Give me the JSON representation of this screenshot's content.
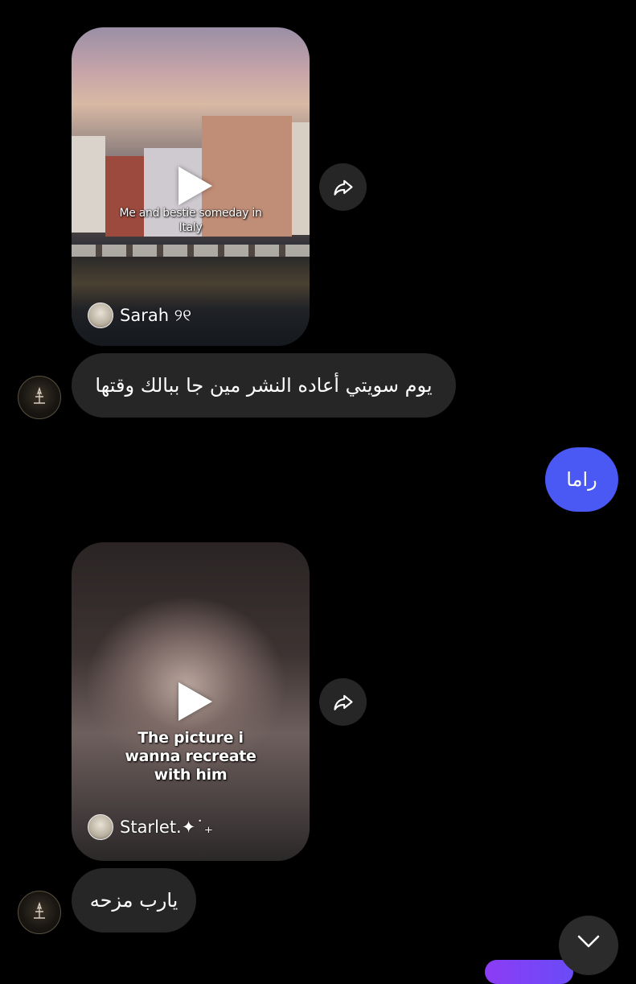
{
  "messages": [
    {
      "type": "reel",
      "caption": "Me and bestie someday in Italy",
      "author": "Sarah ୨୧"
    },
    {
      "type": "text",
      "direction": "incoming",
      "text": "يوم سويتي أعاده النشر مين جا ببالك وقتها"
    },
    {
      "type": "text",
      "direction": "outgoing",
      "text": "راما"
    },
    {
      "type": "reel",
      "caption": "The picture i wanna recreate with him",
      "author": "Starlet.✦˙₊"
    },
    {
      "type": "text",
      "direction": "incoming",
      "text": "يارب مزحه"
    }
  ],
  "icons": {
    "play": "play-icon",
    "share": "share-icon",
    "scroll_down": "chevron-down-icon"
  },
  "colors": {
    "background": "#000000",
    "incoming_bubble": "#262626",
    "outgoing_bubble": "#4a58f4",
    "share_button": "#262626"
  }
}
